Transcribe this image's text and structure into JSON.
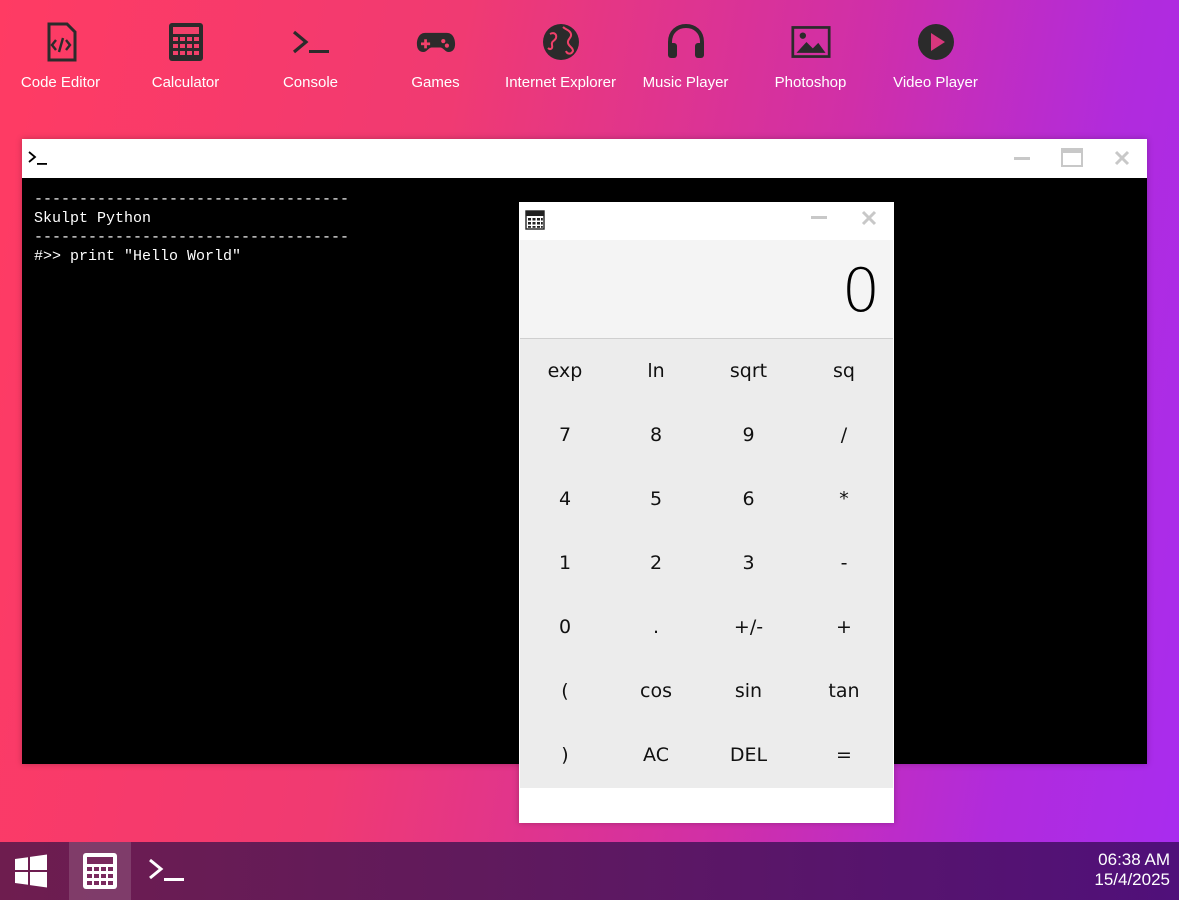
{
  "desktop": {
    "icons": [
      {
        "label": "Code Editor",
        "icon": "code-file-icon"
      },
      {
        "label": "Calculator",
        "icon": "calculator-icon"
      },
      {
        "label": "Console",
        "icon": "terminal-icon"
      },
      {
        "label": "Games",
        "icon": "gamepad-icon"
      },
      {
        "label": "Internet Explorer",
        "icon": "globe-icon"
      },
      {
        "label": "Music Player",
        "icon": "headphones-icon"
      },
      {
        "label": "Photoshop",
        "icon": "image-icon"
      },
      {
        "label": "Video Player",
        "icon": "play-circle-icon"
      }
    ]
  },
  "console": {
    "title_icon": "terminal-icon",
    "lines": [
      "-----------------------------------",
      "Skulpt Python",
      "-----------------------------------",
      "#>> print \"Hello World\""
    ]
  },
  "calculator": {
    "title_icon": "calculator-icon",
    "display": "0",
    "keys": [
      "exp",
      "ln",
      "sqrt",
      "sq",
      "7",
      "8",
      "9",
      "/",
      "4",
      "5",
      "6",
      "*",
      "1",
      "2",
      "3",
      "-",
      "0",
      ".",
      "+/-",
      "+",
      "(",
      "cos",
      "sin",
      "tan",
      ")",
      "AC",
      "DEL",
      "="
    ]
  },
  "taskbar": {
    "items": [
      {
        "icon": "windows-start-icon",
        "active": false
      },
      {
        "icon": "calculator-icon",
        "active": true
      },
      {
        "icon": "terminal-icon",
        "active": false
      }
    ],
    "time": "06:38 AM",
    "date": "15/4/2025"
  },
  "colors": {
    "icon_dark": "#2b2b2b",
    "console_bg": "#000000",
    "calc_keys_bg": "#ececec",
    "calc_display_bg": "#f4f4f4"
  }
}
